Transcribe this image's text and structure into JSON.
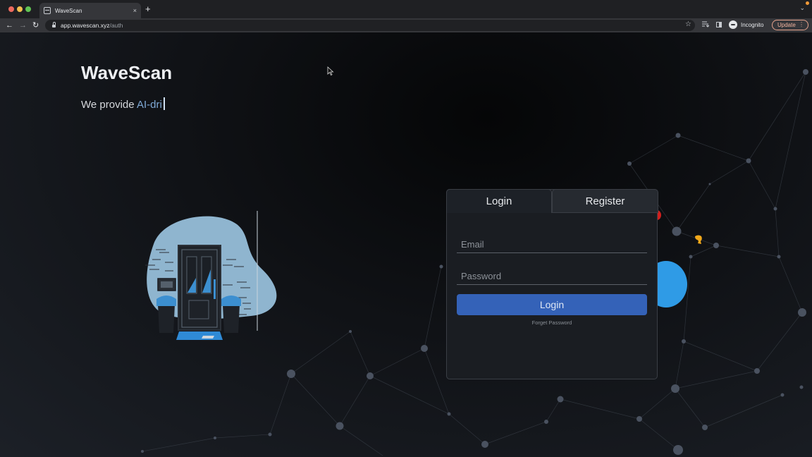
{
  "browser": {
    "tab_title": "WaveScan",
    "tab_close": "×",
    "new_tab": "+",
    "tab_menu": "⌄",
    "url_host": "app.wavescan.xyz",
    "url_path": "/auth",
    "back": "←",
    "forward": "→",
    "reload": "↻",
    "bookmark": "☆",
    "incognito_label": "Incognito",
    "update_label": "Update",
    "update_menu": "⋮"
  },
  "hero": {
    "title": "WaveScan",
    "tagline_prefix": "We provide ",
    "tagline_typed": "AI-dri"
  },
  "auth": {
    "tabs": [
      "Login",
      "Register"
    ],
    "active_tab": "Login",
    "email_placeholder": "Email",
    "password_placeholder": "Password",
    "email_value": "",
    "password_value": "",
    "submit_label": "Login",
    "forgot_label": "Forget Password"
  },
  "colors": {
    "accent": "#3462b8",
    "tagline_accent": "#7fa9d6",
    "illustration_blob": "#8fb5cf"
  }
}
